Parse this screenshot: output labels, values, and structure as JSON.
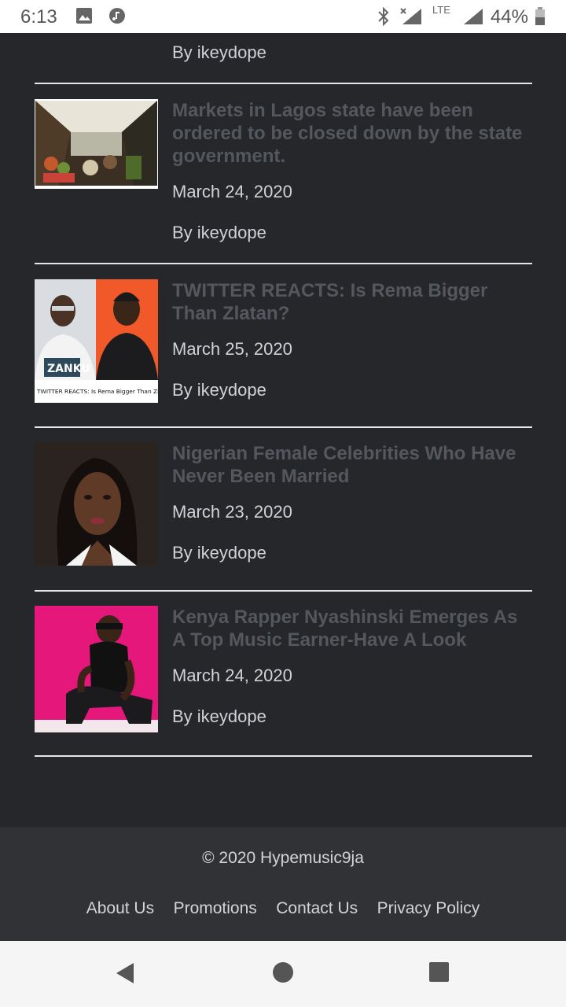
{
  "status_bar": {
    "time": "6:13",
    "network": "LTE",
    "battery": "44%"
  },
  "feed": {
    "top_author": "By ikeydope",
    "posts": [
      {
        "title": "Markets in Lagos state have been ordered to be closed down by the state government.",
        "date": "March 24, 2020",
        "author": "By ikeydope",
        "thumb": "market-photo"
      },
      {
        "title": "TWITTER REACTS: Is Rema Bigger Than Zlatan?",
        "date": "March 25, 2020",
        "author": "By ikeydope",
        "thumb": "rema-zlatan-photo",
        "thumb_caption": "TWITTER REACTS: Is Rema Bigger Than Zlatan?",
        "shirt_text": "ZANKU"
      },
      {
        "title": "Nigerian Female Celebrities Who Have Never Been Married",
        "date": "March 23, 2020",
        "author": "By ikeydope",
        "thumb": "celebrity-portrait"
      },
      {
        "title": "Kenya Rapper Nyashinski Emerges As A Top Music Earner-Have A Look",
        "date": "March 24, 2020",
        "author": "By ikeydope",
        "thumb": "rapper-photo"
      }
    ]
  },
  "footer": {
    "copyright": "© 2020 Hypemusic9ja",
    "links": [
      "About Us",
      "Promotions",
      "Contact Us",
      "Privacy Policy"
    ]
  },
  "colors": {
    "background": "#25272b",
    "footer": "#303236",
    "title": "#54575d",
    "text": "#cfd2d6"
  }
}
